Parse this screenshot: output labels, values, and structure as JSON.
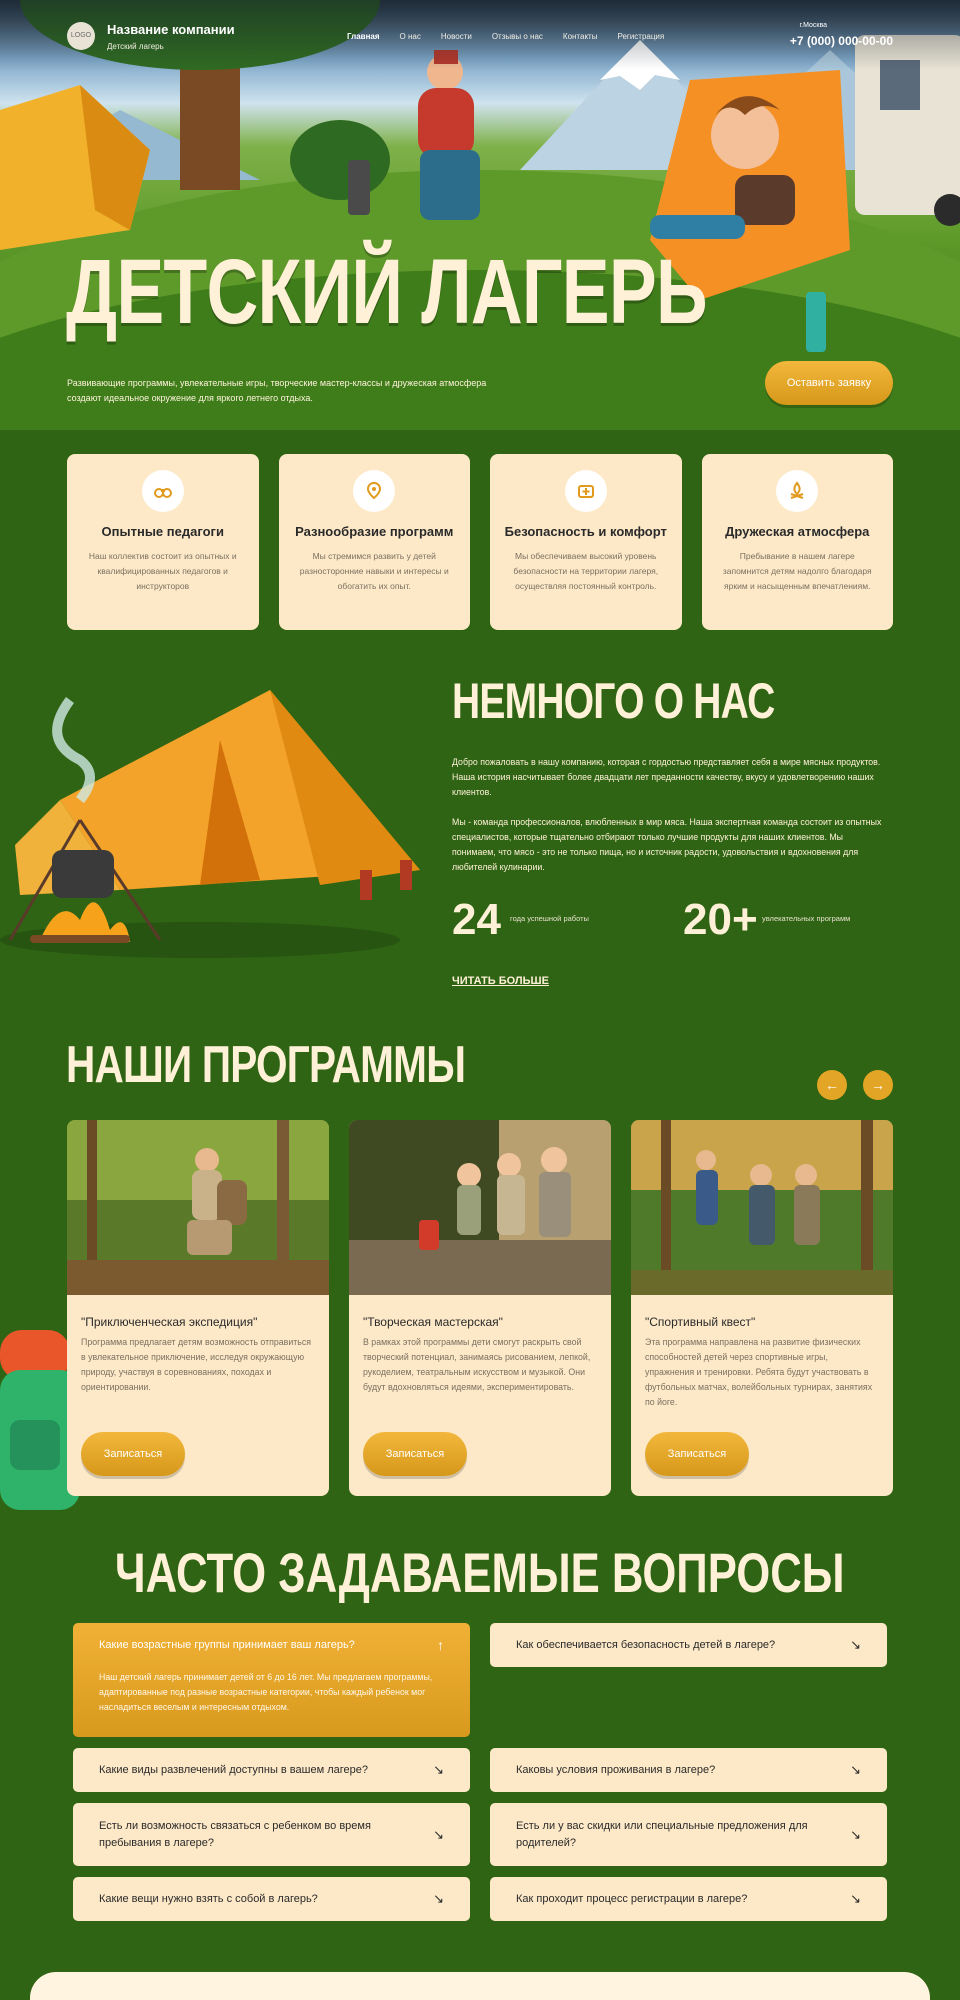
{
  "header": {
    "logo_text": "LOGO",
    "company_name": "Название компании",
    "company_sub": "Детский лагерь",
    "nav": [
      "Главная",
      "О нас",
      "Новости",
      "Отзывы о нас",
      "Контакты",
      "Регистрация"
    ],
    "city": "г.Москва",
    "phone": "+7 (000) 000-00-00"
  },
  "hero": {
    "title": "ДЕТСКИЙ ЛАГЕРЬ",
    "text": "Развивающие программы, увлекательные игры, творческие мастер-классы и дружеская атмосфера создают идеальное окружение для яркого летнего отдыха.",
    "button": "Оставить заявку"
  },
  "features": [
    {
      "icon": "binoculars-icon",
      "title": "Опытные педагоги",
      "text": "Наш коллектив состоит из опытных и квалифицированных педагогов и инструкторов"
    },
    {
      "icon": "map-pin-icon",
      "title": "Разнообразие программ",
      "text": "Мы стремимся развить у детей разносторонние навыки и интересы и обогатить их опыт."
    },
    {
      "icon": "first-aid-icon",
      "title": "Безопасность и комфорт",
      "text": "Мы обеспечиваем высокий уровень безопасности на территории лагеря, осуществляя постоянный контроль."
    },
    {
      "icon": "campfire-icon",
      "title": "Дружеская атмосфера",
      "text": "Пребывание в нашем лагере запомнится детям надолго благодаря ярким и насыщенным впечатлениям."
    }
  ],
  "about": {
    "title": "НЕМНОГО О НАС",
    "p1": "Добро пожаловать в нашу компанию, которая с гордостью представляет себя в мире мясных продуктов. Наша история насчитывает более двадцати лет преданности качеству, вкусу и удовлетворению наших клиентов.",
    "p2": "Мы - команда профессионалов, влюбленных в мир мяса. Наша экспертная команда состоит из опытных специалистов, которые тщательно отбирают только лучшие продукты для наших клиентов. Мы понимаем, что мясо - это не только пища, но и источник радости, удовольствия и вдохновения для любителей кулинарии.",
    "stat1_num": "24",
    "stat1_label": "года успешной работы",
    "stat2_num": "20+",
    "stat2_label": "увлекательных программ",
    "read_more": "ЧИТАТЬ БОЛЬШЕ"
  },
  "programs": {
    "title": "НАШИ ПРОГРАММЫ",
    "prev": "←",
    "next": "→",
    "items": [
      {
        "title": "\"Приключенческая экспедиция\"",
        "text": "Программа предлагает детям возможность отправиться в увлекательное приключение, исследуя окружающую природу, участвуя в соревнованиях, походах и ориентировании.",
        "button": "Записаться"
      },
      {
        "title": "\"Творческая мастерская\"",
        "text": "В рамках этой программы дети смогут раскрыть свой творческий потенциал, занимаясь рисованием, лепкой, рукоделием, театральным искусством и музыкой. Они будут вдохновляться идеями, экспериментировать.",
        "button": "Записаться"
      },
      {
        "title": "\"Спортивный квест\"",
        "text": "Эта программа направлена на развитие физических способностей детей через спортивные игры, упражнения и тренировки. Ребята будут участвовать в футбольных матчах, волейбольных турнирах, занятиях по йоге.",
        "button": "Записаться"
      }
    ]
  },
  "faq": {
    "title": "ЧАСТО ЗАДАВАЕМЫЕ ВОПРОСЫ",
    "open": {
      "q": "Какие возрастные группы принимает ваш лагерь?",
      "a": "Наш детский лагерь принимает детей от 6 до 16 лет. Мы предлагаем программы, адаптированные под разные возрастные категории, чтобы каждый ребенок мог насладиться веселым и интересным отдыхом.",
      "icon": "↑"
    },
    "items": [
      {
        "q": "Как обеспечивается безопасность детей в лагере?",
        "icon": "↘"
      },
      {
        "q": "Какие виды развлечений доступны в вашем лагере?",
        "icon": "↘"
      },
      {
        "q": "Каковы условия проживания в лагере?",
        "icon": "↘"
      },
      {
        "q": "Есть ли возможность связаться с ребенком во время пребывания в лагере?",
        "icon": "↘"
      },
      {
        "q": "Есть ли у вас скидки или специальные предложения для родителей?",
        "icon": "↘"
      },
      {
        "q": "Какие вещи нужно взять с собой в лагерь?",
        "icon": "↘"
      },
      {
        "q": "Как проходит процесс регистрации в лагере?",
        "icon": "↘"
      }
    ]
  },
  "colors": {
    "accent": "#e3a526",
    "background": "#2f6414",
    "card": "#fde9c8",
    "title": "#fff1d8"
  }
}
